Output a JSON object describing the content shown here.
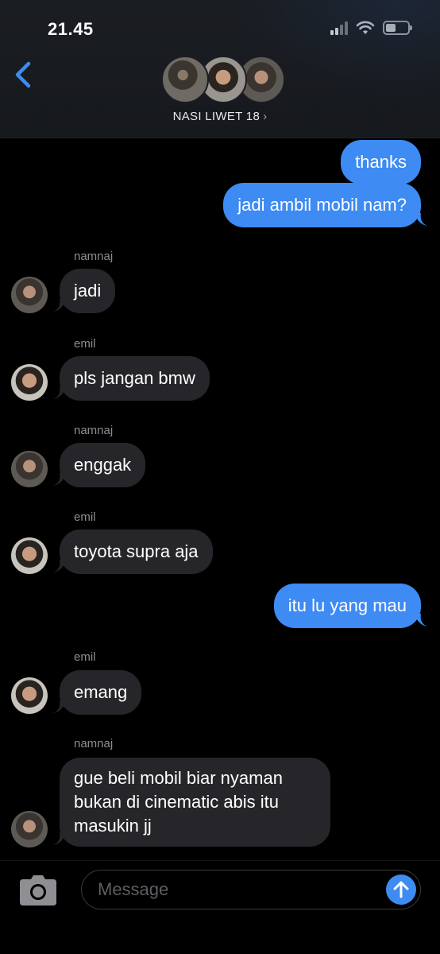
{
  "status_bar": {
    "time": "21.45"
  },
  "header": {
    "group_name": "NASI LIWET 18",
    "chevron": "›"
  },
  "messages": [
    {
      "type": "outgoing",
      "text": "thanks"
    },
    {
      "type": "outgoing",
      "text": "jadi ambil mobil nam?"
    },
    {
      "type": "incoming",
      "sender": "namnaj",
      "text": "jadi"
    },
    {
      "type": "incoming",
      "sender": "emil",
      "text": "pls jangan bmw"
    },
    {
      "type": "incoming",
      "sender": "namnaj",
      "text": "enggak"
    },
    {
      "type": "incoming",
      "sender": "emil",
      "text": "toyota supra aja"
    },
    {
      "type": "outgoing",
      "text": "itu lu yang mau"
    },
    {
      "type": "incoming",
      "sender": "emil",
      "text": "emang"
    },
    {
      "type": "incoming",
      "sender": "namnaj",
      "lines": [
        "gue beli mobil biar nyaman",
        "bukan di cinematic abis itu",
        "masukin jj"
      ]
    }
  ],
  "input": {
    "placeholder": "Message"
  },
  "colors": {
    "outgoing_bubble": "#3d8bf3",
    "incoming_bubble": "#26262a",
    "accent": "#3d8bf3"
  },
  "icons": [
    "back-chevron-icon",
    "signal-icon",
    "wifi-icon",
    "battery-icon",
    "camera-icon",
    "send-arrow-icon"
  ]
}
